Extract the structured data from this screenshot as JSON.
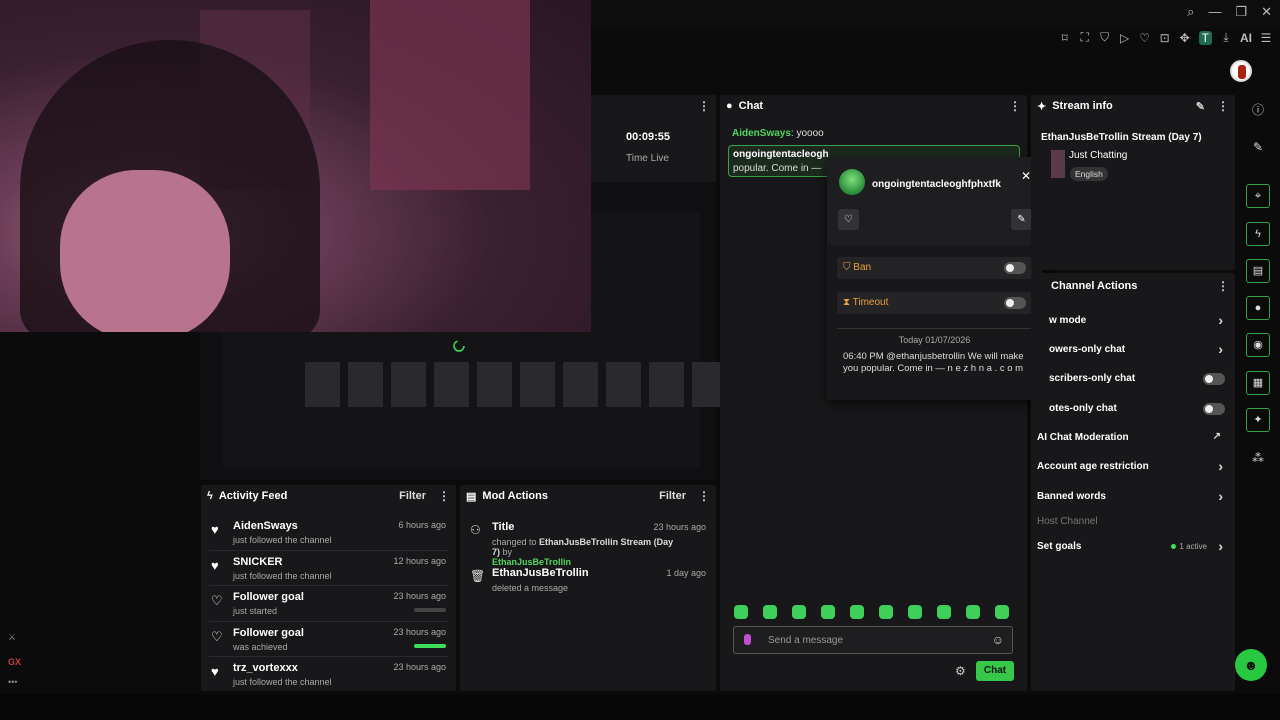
{
  "colors": {
    "accent": "#37c84a",
    "username_green": "#52d65e",
    "warning_orange": "#e8a33b",
    "panel_bg": "#18181a"
  },
  "toolbar": {
    "icons": [
      "search-icon",
      "minimize-icon",
      "restore-icon",
      "close-icon"
    ],
    "glyphs": [
      "⌕",
      "—",
      "❐",
      "✕"
    ],
    "ext_t": "T",
    "ext_ai": "AI"
  },
  "session": {
    "time": "00:09:55",
    "label": "Time Live"
  },
  "chat": {
    "title": "Chat",
    "messages": [
      {
        "user": "AidenSways",
        "text": " yoooo"
      },
      {
        "user": "ongoingtentacleogh",
        "text": "popular. Come in —"
      }
    ],
    "input_placeholder": "Send a message",
    "send_label": "Chat"
  },
  "popup": {
    "username": "ongoingtentacleoghfphxtfk",
    "ban_label": "Ban",
    "timeout_label": "Timeout",
    "date": "Today 01/07/2026",
    "message": "06:40 PM @ethanjusbetrollin We will make you popular. Come in — n e z h n a . c o m"
  },
  "activity": {
    "title": "Activity Feed",
    "filter": "Filter",
    "items": [
      {
        "name": "AidenSways",
        "sub": "just followed the channel",
        "time": "6 hours ago"
      },
      {
        "name": "SNICKER",
        "sub": "just followed the channel",
        "time": "12 hours ago"
      },
      {
        "name": "Follower goal",
        "sub": "just started",
        "time": "23 hours ago"
      },
      {
        "name": "Follower goal",
        "sub": "was achieved",
        "time": "23 hours ago"
      },
      {
        "name": "trz_vortexxx",
        "sub": "just followed the channel",
        "time": "23 hours ago"
      }
    ],
    "goal_progress": [
      0,
      1
    ]
  },
  "mod": {
    "title": "Mod Actions",
    "filter": "Filter",
    "items": [
      {
        "name": "Title",
        "time": "23 hours ago",
        "pre": "changed to ",
        "bold": "EthanJusBeTrollin Stream (Day 7)",
        "mid": " by ",
        "green": "EthanJusBeTrollin"
      },
      {
        "name": "EthanJusBeTrollin",
        "time": "1 day ago",
        "desc": "deleted a message"
      }
    ]
  },
  "stream_info": {
    "title": "Stream info",
    "stream_title": "EthanJusBeTrollin Stream (Day 7)",
    "category": "Just Chatting",
    "tag": "English"
  },
  "channel_actions": {
    "title": "Channel Actions",
    "rows": [
      {
        "label": "w mode"
      },
      {
        "label": "owers-only chat"
      },
      {
        "label": "scribers-only chat"
      },
      {
        "label": "otes-only chat"
      },
      {
        "label": "AI Chat Moderation"
      },
      {
        "label": "Account age restriction"
      },
      {
        "label": "Banned words"
      },
      {
        "label": "Host Channel"
      },
      {
        "label": "Set goals",
        "active": "1 active"
      }
    ]
  },
  "left_rail": {
    "gx": "GX",
    "more": "•••"
  }
}
